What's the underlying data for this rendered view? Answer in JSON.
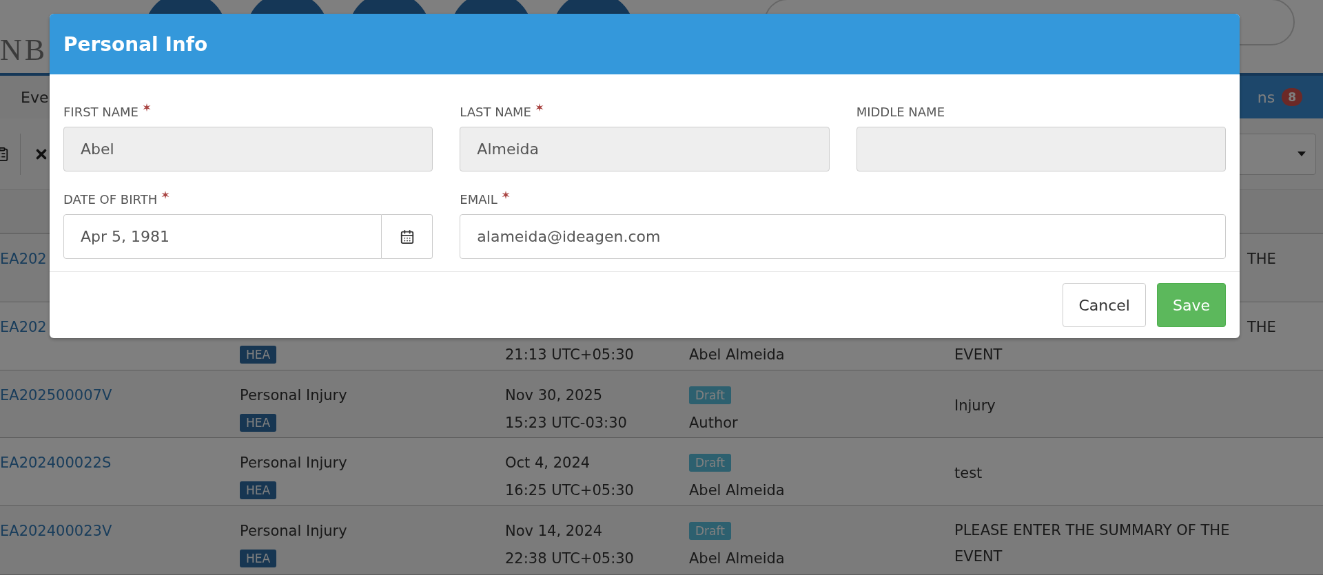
{
  "header": {
    "logo_lines": [
      "NB"
    ]
  },
  "nav": {
    "items": [
      {
        "label": "Eve",
        "selected": true
      },
      {
        "label": "ns",
        "badge": "8",
        "selected": false
      }
    ]
  },
  "table": {
    "rows": [
      {
        "id": "EA202",
        "summary_end": "THE"
      },
      {
        "id": "EA202",
        "tag": "HEA",
        "time": "21:13 UTC+05:30",
        "author": "Abel Almeida",
        "summary": "EVENT",
        "summary_end": "THE"
      },
      {
        "id": "EA202500007V",
        "type": "Personal Injury",
        "tag": "HEA",
        "date": "Nov 30, 2025",
        "time": "15:23 UTC-03:30",
        "status": "Draft",
        "author": "Author",
        "summary": "Injury"
      },
      {
        "id": "EA202400022S",
        "type": "Personal Injury",
        "tag": "HEA",
        "date": "Oct 4, 2024",
        "time": "16:25 UTC+05:30",
        "status": "Draft",
        "author": "Abel Almeida",
        "summary": "test"
      },
      {
        "id": "EA202400023V",
        "type": "Personal Injury",
        "tag": "HEA",
        "date": "Nov 14, 2024",
        "time": "22:38 UTC+05:30",
        "status": "Draft",
        "author": "Abel Almeida",
        "summary": "PLEASE ENTER THE SUMMARY OF THE EVENT"
      }
    ]
  },
  "dialog": {
    "title": "Personal Info",
    "fields": [
      {
        "label": "FIRST NAME",
        "required": true,
        "value": "Abel",
        "disabled": true,
        "kind": "text",
        "wide": false
      },
      {
        "label": "LAST NAME",
        "required": true,
        "value": "Almeida",
        "disabled": true,
        "kind": "text",
        "wide": false
      },
      {
        "label": "MIDDLE NAME",
        "required": false,
        "disabled": true,
        "kind": "text",
        "wide": false
      },
      {
        "label": "DATE OF BIRTH",
        "required": true,
        "value": "Apr 5, 1981",
        "disabled": false,
        "kind": "date",
        "wide": false
      },
      {
        "label": "EMAIL",
        "required": true,
        "value": "alameida@ideagen.com",
        "disabled": false,
        "kind": "text",
        "wide": true
      }
    ],
    "buttons": [
      {
        "label": "Cancel",
        "kind": "default"
      },
      {
        "label": "Save",
        "kind": "primary"
      }
    ]
  }
}
